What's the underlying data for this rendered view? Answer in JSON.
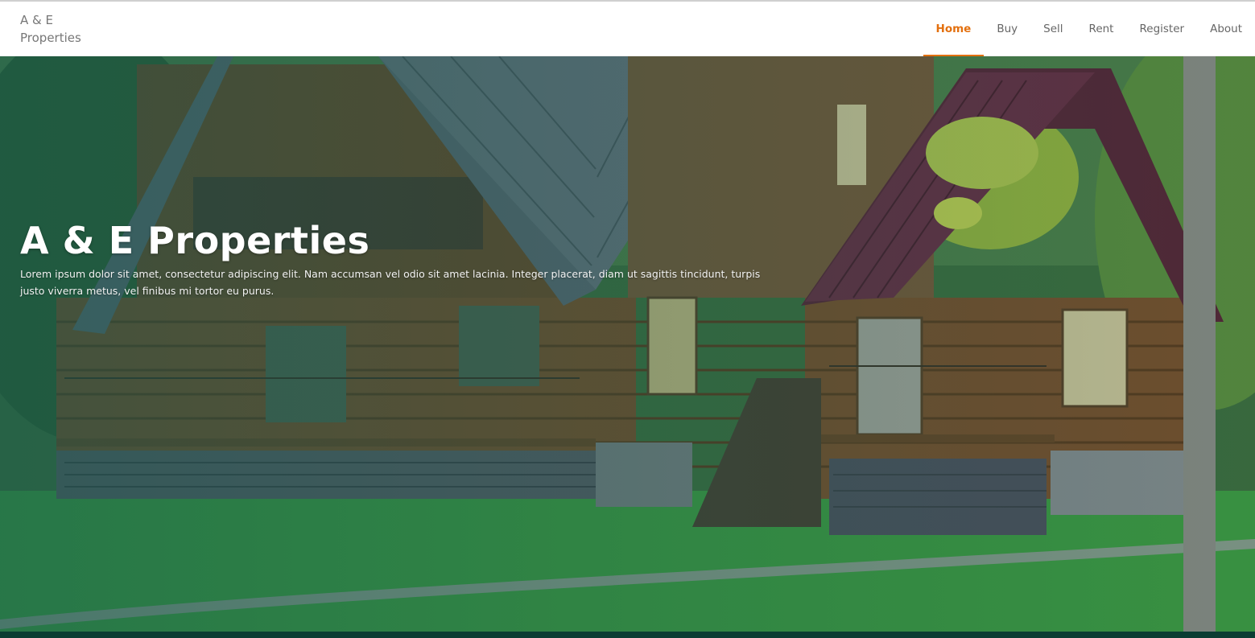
{
  "brand": {
    "line1": "A & E",
    "line2": "Properties"
  },
  "nav": {
    "items": [
      {
        "label": "Home",
        "active": true
      },
      {
        "label": "Buy",
        "active": false
      },
      {
        "label": "Sell",
        "active": false
      },
      {
        "label": "Rent",
        "active": false
      },
      {
        "label": "Register",
        "active": false
      },
      {
        "label": "About",
        "active": false
      }
    ]
  },
  "hero": {
    "title": "A & E Properties",
    "text": "Lorem ipsum dolor sit amet, consectetur adipiscing elit. Nam accumsan vel odio sit amet lacinia. Integer placerat, diam ut sagittis tincidunt, turpis justo viverra metus, vel finibus mi tortor eu purus."
  },
  "colors": {
    "accent": "#e3700f",
    "nav_text": "#666666",
    "brand_text": "#777777",
    "overlay": "#145a50",
    "footer_strip": "#0b3d33"
  }
}
